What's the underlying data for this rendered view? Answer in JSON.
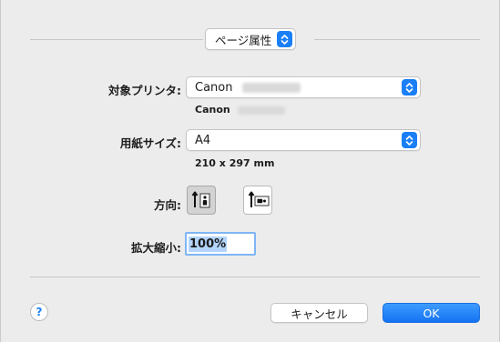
{
  "tab_popup": {
    "label": "ページ属性"
  },
  "printer": {
    "label": "対象プリンタ:",
    "value": "Canon",
    "sub_value": "Canon"
  },
  "paper_size": {
    "label": "用紙サイズ:",
    "value": "A4",
    "dimensions": "210 x 297 mm"
  },
  "orientation": {
    "label": "方向:",
    "options": [
      "portrait",
      "landscape"
    ],
    "selected": "portrait"
  },
  "scale": {
    "label": "拡大縮小:",
    "value": "100%"
  },
  "footer": {
    "help_label": "?",
    "cancel_label": "キャンセル",
    "ok_label": "OK"
  },
  "colors": {
    "accent": "#1a7ff7",
    "background": "#ececec"
  }
}
